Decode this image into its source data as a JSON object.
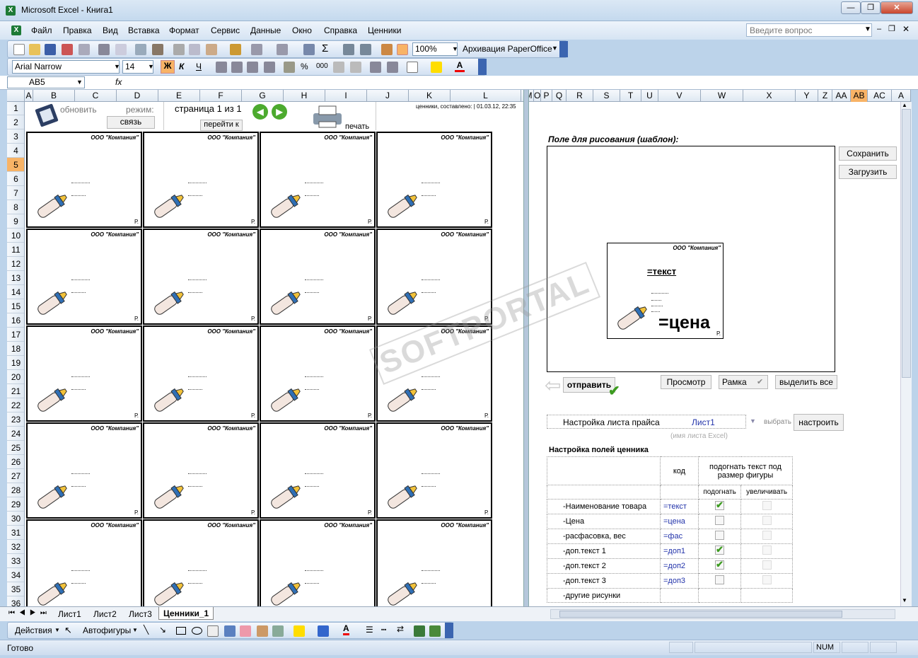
{
  "window": {
    "title": "Microsoft Excel - Книга1",
    "minimize_icon": "minimize-icon",
    "restore_icon": "restore-icon",
    "close_icon": "close-icon"
  },
  "menu": {
    "items": [
      "Файл",
      "Правка",
      "Вид",
      "Вставка",
      "Формат",
      "Сервис",
      "Данные",
      "Окно",
      "Справка",
      "Ценники"
    ],
    "ask_placeholder": "Введите вопрос"
  },
  "toolbar": {
    "zoom": "100%",
    "archive_label": "Архивация PaperOffice"
  },
  "format_toolbar": {
    "font": "Arial Narrow",
    "size": "14",
    "bold": "Ж",
    "italic": "К",
    "underline": "Ч"
  },
  "formula_bar": {
    "name_box": "AB5",
    "fx": "fx",
    "formula": ""
  },
  "columns_left": [
    "A",
    "B",
    "C",
    "D",
    "E",
    "F",
    "G",
    "H",
    "I",
    "J",
    "K",
    "L"
  ],
  "columns_right": [
    "M",
    "O",
    "P",
    "Q",
    "R",
    "S",
    "T",
    "U",
    "V",
    "W",
    "X",
    "Y",
    "Z",
    "AA",
    "AB",
    "AC",
    "A"
  ],
  "rows": [
    "1",
    "2",
    "3",
    "4",
    "5",
    "6",
    "7",
    "8",
    "9",
    "10",
    "11",
    "12",
    "13",
    "14",
    "15",
    "16",
    "17",
    "18",
    "19",
    "20",
    "21",
    "22",
    "23",
    "24",
    "25",
    "26",
    "27",
    "28",
    "29",
    "30",
    "31",
    "32",
    "33",
    "34",
    "35",
    "36"
  ],
  "sheet_top": {
    "update_label": "обновить",
    "mode_label": "режим:",
    "link_button": "связь",
    "page_label": "страница 1 из 1",
    "goto_label": "перейти к",
    "print_label": "печать",
    "created_label": "ценники, составлено: | 01.03.12, 22:35"
  },
  "label": {
    "company": "ООО \"Компания\"",
    "currency": "Р."
  },
  "right_panel": {
    "draw_title": "Поле для рисования (шаблон):",
    "save_button": "Сохранить",
    "load_button": "Загрузить",
    "template_company": "ООО \"Компания\"",
    "template_text": "=текст",
    "template_price": "=цена",
    "template_currency": "Р.",
    "send_button": "отправить",
    "preview_button": "Просмотр",
    "frame_button": "Рамка",
    "select_all_button": "выделить все",
    "price_sheet_label": "Настройка листа прайса",
    "sheet_name": "Лист1",
    "choose_label": "выбрать",
    "setup_button": "настроить",
    "sheet_hint": "(имя листа Excel)",
    "fields_title": "Настройка полей ценника",
    "col_code": "код",
    "col_fit": "подогнать текст под размер фигуры",
    "col_fit_sub": "подогнать",
    "col_enlarge_sub": "увеличивать",
    "fields": [
      {
        "name": "-Наименование товара",
        "code": "=текст",
        "fit": true
      },
      {
        "name": "-Цена",
        "code": "=цена",
        "fit": false
      },
      {
        "name": "-расфасовка, вес",
        "code": "=фас",
        "fit": false
      },
      {
        "name": "-доп.текст 1",
        "code": "=доп1",
        "fit": true
      },
      {
        "name": "-доп.текст 2",
        "code": "=доп2",
        "fit": true
      },
      {
        "name": "-доп.текст 3",
        "code": "=доп3",
        "fit": false
      },
      {
        "name": "-другие рисунки",
        "code": "",
        "fit": null
      }
    ]
  },
  "tabs": [
    "Лист1",
    "Лист2",
    "Лист3",
    "Ценники_1"
  ],
  "draw_toolbar": {
    "actions": "Действия",
    "autoshapes": "Автофигуры"
  },
  "status": {
    "ready": "Готово",
    "num": "NUM"
  },
  "watermark": "SOFTPORTAL",
  "colors": {
    "title_bg": "#c4d9ee",
    "toolbar_bg": "#d2e1f2",
    "selected_header": "#f8b366"
  }
}
